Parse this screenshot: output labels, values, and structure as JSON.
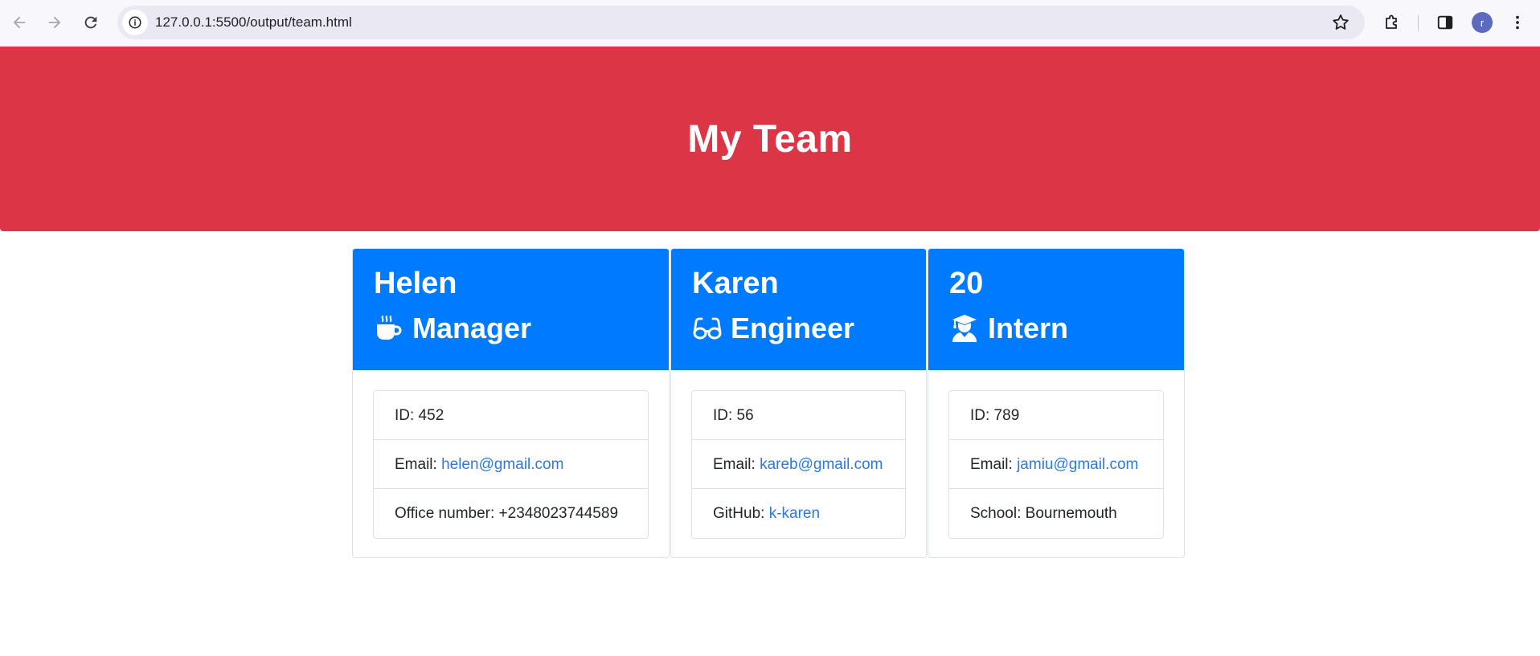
{
  "browser": {
    "url": "127.0.0.1:5500/output/team.html",
    "avatar_letter": "r"
  },
  "header": {
    "title": "My Team"
  },
  "team": [
    {
      "name": "Helen",
      "role": "Manager",
      "icon": "mug-hot-icon",
      "id_label": "ID: 452",
      "email_prefix": "Email: ",
      "email": "helen@gmail.com",
      "extra_prefix": "Office number: ",
      "extra_value": "+2348023744589"
    },
    {
      "name": "Karen",
      "role": "Engineer",
      "icon": "glasses-icon",
      "id_label": "ID: 56",
      "email_prefix": "Email: ",
      "email": "kareb@gmail.com",
      "extra_prefix": "GitHub: ",
      "extra_value": "k-karen"
    },
    {
      "name": "20",
      "role": "Intern",
      "icon": "user-graduate-icon",
      "id_label": "ID: 789",
      "email_prefix": "Email: ",
      "email": "jamiu@gmail.com",
      "extra_prefix": "School: ",
      "extra_value": "Bournemouth"
    }
  ],
  "colors": {
    "header_bg": "#dc3545",
    "card_header_bg": "#007bff",
    "link": "#2a7ae2"
  }
}
